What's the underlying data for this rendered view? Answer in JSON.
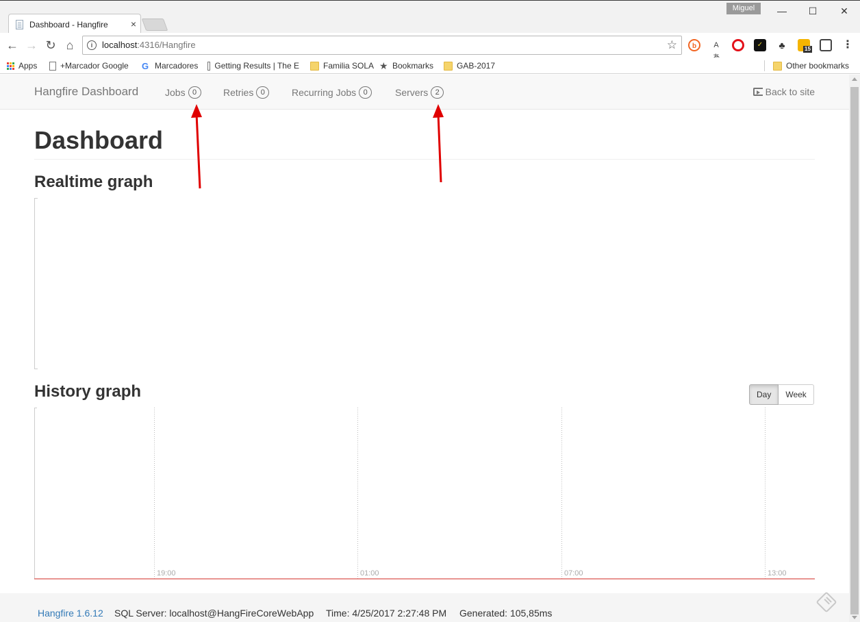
{
  "browser": {
    "tab_title": "Dashboard - Hangfire",
    "tab_close": "×",
    "user": "Miguel",
    "url_host": "localhost",
    "url_rest": ":4316/Hangfire",
    "bookmarks": [
      {
        "label": "Apps",
        "icon": "apps-grid-icon"
      },
      {
        "label": "+Marcador Google",
        "icon": "page-icon"
      },
      {
        "label": "Marcadores",
        "icon": "google-icon"
      },
      {
        "label": "Getting Results | The E",
        "icon": "page-icon"
      },
      {
        "label": "Familia SOLA",
        "icon": "folder-icon"
      },
      {
        "label": "Bookmarks",
        "icon": "star-icon"
      },
      {
        "label": "GAB-2017",
        "icon": "folder-icon"
      }
    ],
    "other_bookmarks": "Other bookmarks",
    "extension_badge": "15"
  },
  "nav": {
    "brand": "Hangfire Dashboard",
    "items": [
      {
        "label": "Jobs",
        "count": "0"
      },
      {
        "label": "Retries",
        "count": "0"
      },
      {
        "label": "Recurring Jobs",
        "count": "0"
      },
      {
        "label": "Servers",
        "count": "2"
      }
    ],
    "back": "Back to site"
  },
  "main": {
    "title": "Dashboard",
    "realtime_title": "Realtime graph",
    "history_title": "History graph",
    "range_buttons": {
      "day": "Day",
      "week": "Week",
      "selected": "Day"
    }
  },
  "chart_data": {
    "type": "line",
    "x_ticks": [
      "19:00",
      "01:00",
      "07:00",
      "13:00"
    ],
    "series": [
      {
        "color": "#d9534f",
        "values": [
          0,
          0,
          0,
          0
        ]
      }
    ],
    "grid": "vertical dotted"
  },
  "footer": {
    "version": "Hangfire 1.6.12",
    "storage": "SQL Server: localhost@HangFireCoreWebApp",
    "time": "Time: 4/25/2017 2:27:48 PM",
    "generated": "Generated: 105,85ms"
  },
  "annotations": {
    "arrow_color": "#e00000"
  }
}
